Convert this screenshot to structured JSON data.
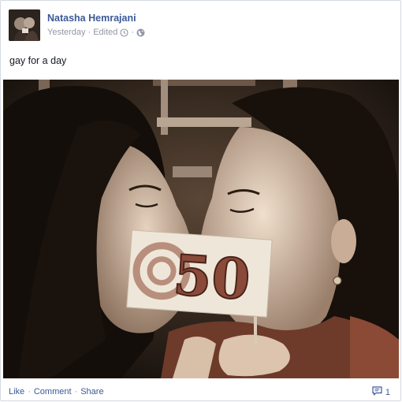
{
  "post": {
    "author": "Natasha Hemrajani",
    "timestamp": "Yesterday",
    "edited_label": "Edited",
    "message": "gay for a day",
    "photo_sign_text": "50"
  },
  "actions": {
    "like": "Like",
    "comment": "Comment",
    "share": "Share",
    "comment_count": "1"
  },
  "icons": {
    "edit_history": "clock-icon",
    "audience": "globe-icon",
    "comments": "comment-bubble-icon"
  },
  "colors": {
    "link": "#3b5998",
    "meta": "#9197a3",
    "border": "#d5d9e2"
  }
}
